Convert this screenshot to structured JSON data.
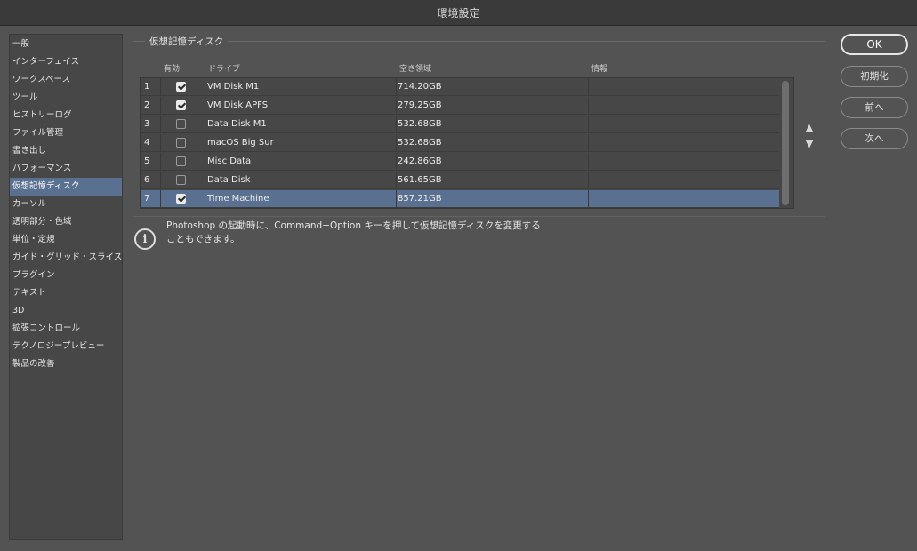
{
  "window": {
    "title": "環境設定"
  },
  "sidebar": {
    "items": [
      {
        "label": "一般"
      },
      {
        "label": "インターフェイス"
      },
      {
        "label": "ワークスペース"
      },
      {
        "label": "ツール"
      },
      {
        "label": "ヒストリーログ"
      },
      {
        "label": "ファイル管理"
      },
      {
        "label": "書き出し"
      },
      {
        "label": "パフォーマンス"
      },
      {
        "label": "仮想記憶ディスク",
        "selected": true
      },
      {
        "label": "カーソル"
      },
      {
        "label": "透明部分・色域"
      },
      {
        "label": "単位・定規"
      },
      {
        "label": "ガイド・グリッド・スライス"
      },
      {
        "label": "プラグイン"
      },
      {
        "label": "テキスト"
      },
      {
        "label": "3D"
      },
      {
        "label": "拡張コントロール"
      },
      {
        "label": "テクノロジープレビュー"
      },
      {
        "label": "製品の改善"
      }
    ]
  },
  "main": {
    "section_title": "仮想記憶ディスク",
    "columns": {
      "enabled": "有効",
      "drive": "ドライブ",
      "free_space": "空き領域",
      "info": "情報"
    },
    "rows": [
      {
        "num": "1",
        "enabled": true,
        "drive": "VM Disk M1",
        "free": "714.20GB",
        "info": ""
      },
      {
        "num": "2",
        "enabled": true,
        "drive": "VM Disk APFS",
        "free": "279.25GB",
        "info": ""
      },
      {
        "num": "3",
        "enabled": false,
        "drive": "Data Disk M1",
        "free": "532.68GB",
        "info": ""
      },
      {
        "num": "4",
        "enabled": false,
        "drive": "macOS Big Sur",
        "free": "532.68GB",
        "info": ""
      },
      {
        "num": "5",
        "enabled": false,
        "drive": "Misc Data",
        "free": "242.86GB",
        "info": ""
      },
      {
        "num": "6",
        "enabled": false,
        "drive": "Data Disk",
        "free": "561.65GB",
        "info": ""
      },
      {
        "num": "7",
        "enabled": true,
        "drive": "Time Machine",
        "free": "857.21GB",
        "info": "",
        "selected": true
      }
    ],
    "move_up": "▲",
    "move_down": "▼",
    "info_icon": "info-icon",
    "info_line1": "Photoshop の起動時に、Command+Option キーを押して仮想記憶ディスクを変更する",
    "info_line2": "こともできます。"
  },
  "buttons": {
    "ok": "OK",
    "reset": "初期化",
    "prev": "前へ",
    "next": "次へ"
  },
  "colors": {
    "accent_selection": "#5a7090",
    "background": "#535353"
  }
}
